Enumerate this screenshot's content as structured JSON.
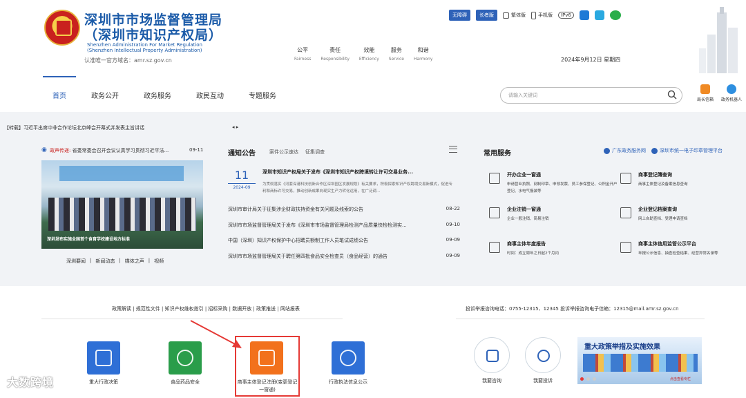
{
  "header": {
    "org_cn_line1": "深圳市市场监督管理局",
    "org_cn_line2": "（深圳市知识产权局）",
    "org_en_line1": "Shenzhen Administration For Market Regulation",
    "org_en_line2": "(Shenzhen Intellectual Property Administration)",
    "domain": "认准唯一官方域名：amr.sz.gov.cn",
    "values": [
      {
        "cn": "公平",
        "en": "Fairness"
      },
      {
        "cn": "责任",
        "en": "Responsibility"
      },
      {
        "cn": "效能",
        "en": "Efficiency"
      },
      {
        "cn": "服务",
        "en": "Service"
      },
      {
        "cn": "和谐",
        "en": "Harmony"
      }
    ],
    "btn_accessible": "无障碍",
    "btn_elder": "长者版",
    "link_traditional": "繁体版",
    "link_mobile": "手机版",
    "link_ipv6": "IPv6",
    "date": "2024年9月12日 星期四"
  },
  "nav": {
    "items": [
      "首页",
      "政务公开",
      "政务服务",
      "政民互动",
      "专题服务"
    ],
    "search_placeholder": "请输入关键词",
    "mailbox": "局长信箱",
    "robot": "政务机器人"
  },
  "ticker": {
    "text": "【转载】习近平出席中非合作论坛北京峰会开幕式并发表主旨讲话",
    "ctl": "◂ ▸"
  },
  "voice": {
    "tag": "政声传递:",
    "text": "省委常委会召开会议认真学习贯彻习近平法...",
    "date": "09-11",
    "caption": "深圳发布实施全国首个食育学校建设地方标准",
    "sublinks": [
      "深圳要闻",
      "|",
      "新闻动态",
      "|",
      "媒体之声",
      "|",
      "视频"
    ]
  },
  "notice": {
    "title": "通知公告",
    "tabs": [
      "案件公示速达",
      "征集调查"
    ],
    "feature_day": "11",
    "feature_month": "2024-09",
    "feature_title": "深圳市知识产权局关于发布《深圳市知识产权跨境转让许可交易业务...",
    "feature_summary": "为贯彻落实《河套深港科技创新合作区深圳园区发展规划》有关要求，积极探索知识产权跨境交易新模式，促进专利和商标许可交易，推动创新成果向现实生产力转化运用，在广泛调...",
    "items": [
      {
        "title": "深圳市审计局关于征集涉企财政扶持资金有关问题及线索的公告",
        "date": "08-22"
      },
      {
        "title": "深圳市市场监督管理局关于发布《深圳市市场监督管理局检测产品质量快检检测实...",
        "date": "09-10"
      },
      {
        "title": "中国（深圳）知识产权保护中心招聘员额制工作人员笔试成绩公告",
        "date": "09-09"
      },
      {
        "title": "深圳市市场监督管理局关于聘任第四批食品安全检查员（食品经营）的通告",
        "date": "09-09"
      }
    ]
  },
  "services": {
    "title": "常用服务",
    "link1": "广东政务服务网",
    "link2": "深圳市统一电子印章管理平台",
    "items": [
      {
        "name": "开办企业一窗通",
        "sub": "申请营业执照、刻制印章、申领发票、员工参保登记、公积金开户登记、水电气报装等"
      },
      {
        "name": "商事登记簿查询",
        "sub": "商事主体登记及备案信息查询"
      },
      {
        "name": "企业注销一窗通",
        "sub": "企业一般注销、简易注销"
      },
      {
        "name": "企业登记档案查询",
        "sub": "网上自助查档、受理申请查档"
      },
      {
        "name": "商事主体年度报告",
        "sub": "时间：成立周年之日起2个月内"
      },
      {
        "name": "商事主体信用监管公示平台",
        "sub": "年报公示信息、抽查检查结果、经营异常名录等"
      }
    ]
  },
  "footer": {
    "links_left": "政策解读 | 规范性文件 | 知识产权维权指引 | 招标采购 | 数据开放 | 政策推送 | 网站报表",
    "hotline": "投诉举报咨询电话：0755-12315、12345      投诉举报咨询电子信箱：12315@mail.amr.sz.gov.cn",
    "tiles": [
      {
        "label": "重大行政决策",
        "color": "#2e6fd6"
      },
      {
        "label": "食品药品安全",
        "color": "#2a9d4a"
      },
      {
        "label": "商事主体登记注册(变更登记一窗通)",
        "color": "#f2711c"
      },
      {
        "label": "行政执法信息公示",
        "color": "#2e6fd6"
      }
    ],
    "consult": "我要咨询",
    "complain": "我要投诉",
    "policy_title": "重大政策举措及实施效果",
    "policy_sub": "点击查看专栏",
    "watermark": "大数跨境"
  }
}
